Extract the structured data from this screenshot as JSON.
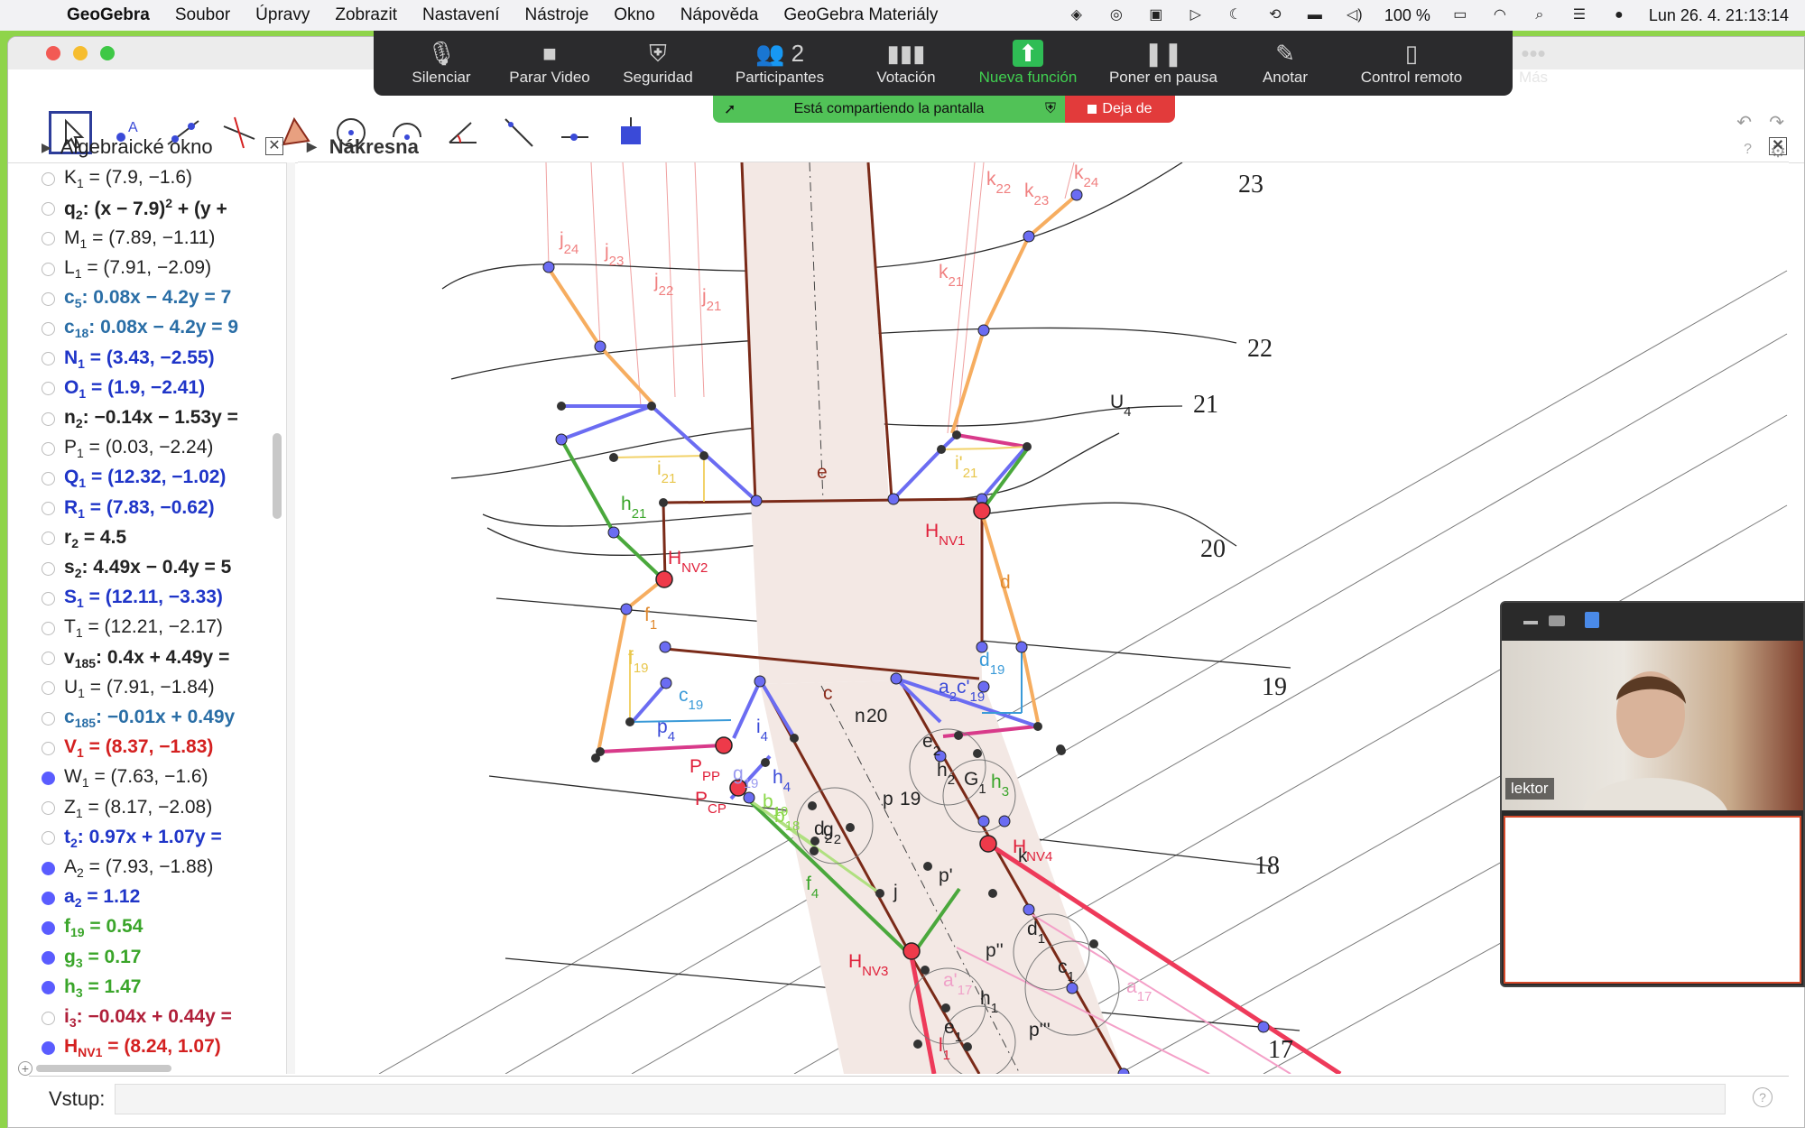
{
  "menubar": {
    "app": "GeoGebra",
    "items": [
      "Soubor",
      "Úpravy",
      "Zobrazit",
      "Nastavení",
      "Nástroje",
      "Okno",
      "Nápověda",
      "GeoGebra Materiály"
    ],
    "battery": "100 %",
    "datetime": "Lun 26. 4.  21:13:14"
  },
  "zoom": {
    "buttons": [
      {
        "label": "Silenciar",
        "icon": "microphone-icon",
        "glyph": "🎙"
      },
      {
        "label": "Parar Video",
        "icon": "video-camera-icon",
        "glyph": "■"
      },
      {
        "label": "Seguridad",
        "icon": "shield-icon",
        "glyph": "⛨"
      },
      {
        "label": "Participantes",
        "icon": "participants-icon",
        "glyph": "👥 2"
      },
      {
        "label": "Votación",
        "icon": "poll-icon",
        "glyph": "▮▮▮"
      },
      {
        "label": "Nueva función",
        "icon": "share-screen-icon",
        "glyph": "⬆"
      },
      {
        "label": "Poner en pausa",
        "icon": "pause-icon",
        "glyph": "❚❚"
      },
      {
        "label": "Anotar",
        "icon": "pencil-icon",
        "glyph": "✎"
      },
      {
        "label": "Control remoto",
        "icon": "mouse-icon",
        "glyph": "▯"
      },
      {
        "label": "Más",
        "icon": "more-icon",
        "glyph": "•••"
      }
    ],
    "share_text": "Está compartiendo la pantalla",
    "stop_text": "Deja de"
  },
  "panels": {
    "algebra_title": "Algebraické okno",
    "canvas_title": "Nákresna"
  },
  "algebra": [
    {
      "html": "K<sub>1</sub> = (7.9, −1.6)",
      "color": "#222222",
      "bold": false,
      "on": false
    },
    {
      "html": "q<sub>2</sub>: (x − 7.9)<sup>2</sup> + (y +",
      "color": "#222222",
      "bold": true,
      "on": false
    },
    {
      "html": "M<sub>1</sub> = (7.89, −1.11)",
      "color": "#222222",
      "bold": false,
      "on": false
    },
    {
      "html": "L<sub>1</sub> = (7.91, −2.09)",
      "color": "#222222",
      "bold": false,
      "on": false
    },
    {
      "html": "c<sub>5</sub>: 0.08x − 4.2y = 7",
      "color": "#2a6ea6",
      "bold": true,
      "on": false
    },
    {
      "html": "c<sub>18</sub>: 0.08x − 4.2y = 9",
      "color": "#2a6ea6",
      "bold": true,
      "on": false
    },
    {
      "html": "N<sub>1</sub> = (3.43, −2.55)",
      "color": "#1f35c8",
      "bold": true,
      "on": false
    },
    {
      "html": "O<sub>1</sub> = (1.9, −2.41)",
      "color": "#1f35c8",
      "bold": true,
      "on": false
    },
    {
      "html": "n<sub>2</sub>: −0.14x − 1.53y =",
      "color": "#222222",
      "bold": true,
      "on": false
    },
    {
      "html": "P<sub>1</sub> = (0.03, −2.24)",
      "color": "#222222",
      "bold": false,
      "on": false
    },
    {
      "html": "Q<sub>1</sub> = (12.32, −1.02)",
      "color": "#1f35c8",
      "bold": true,
      "on": false
    },
    {
      "html": "R<sub>1</sub> = (7.83, −0.62)",
      "color": "#1f35c8",
      "bold": true,
      "on": false
    },
    {
      "html": "r<sub>2</sub> = 4.5",
      "color": "#222222",
      "bold": true,
      "on": false
    },
    {
      "html": "s<sub>2</sub>: 4.49x − 0.4y = 5",
      "color": "#222222",
      "bold": true,
      "on": false
    },
    {
      "html": "S<sub>1</sub> = (12.11, −3.33)",
      "color": "#1f35c8",
      "bold": true,
      "on": false
    },
    {
      "html": "T<sub>1</sub> = (12.21, −2.17)",
      "color": "#222222",
      "bold": false,
      "on": false
    },
    {
      "html": "v<sub>185</sub>: 0.4x + 4.49y =",
      "color": "#222222",
      "bold": true,
      "on": false
    },
    {
      "html": "U<sub>1</sub> = (7.91, −1.84)",
      "color": "#222222",
      "bold": false,
      "on": false
    },
    {
      "html": "c<sub>185</sub>: −0.01x + 0.49y",
      "color": "#2a6ea6",
      "bold": true,
      "on": false
    },
    {
      "html": "V<sub>1</sub> = (8.37, −1.83)",
      "color": "#d42020",
      "bold": true,
      "on": false
    },
    {
      "html": "W<sub>1</sub> = (7.63, −1.6)",
      "color": "#222222",
      "bold": false,
      "on": true
    },
    {
      "html": "Z<sub>1</sub> = (8.17, −2.08)",
      "color": "#222222",
      "bold": false,
      "on": false
    },
    {
      "html": "t<sub>2</sub>: 0.97x + 1.07y =",
      "color": "#1f35c8",
      "bold": true,
      "on": false
    },
    {
      "html": "A<sub>2</sub> = (7.93, −1.88)",
      "color": "#222222",
      "bold": false,
      "on": true
    },
    {
      "html": "a<sub>2</sub> = 1.12",
      "color": "#1f35c8",
      "bold": true,
      "on": true
    },
    {
      "html": "f<sub>19</sub> = 0.54",
      "color": "#3aa52a",
      "bold": true,
      "on": true
    },
    {
      "html": "g<sub>3</sub> = 0.17",
      "color": "#3aa52a",
      "bold": true,
      "on": true
    },
    {
      "html": "h<sub>3</sub> = 1.47",
      "color": "#3aa52a",
      "bold": true,
      "on": true
    },
    {
      "html": "i<sub>3</sub>: −0.04x + 0.44y =",
      "color": "#b0203a",
      "bold": true,
      "on": false
    },
    {
      "html": "H<sub>NV1</sub> = (8.24, 1.07)",
      "color": "#d42020",
      "bold": true,
      "on": true
    }
  ],
  "input": {
    "label": "Vstup:"
  },
  "video": {
    "name": "lektor"
  },
  "canvas": {
    "contour_labels": [
      "23",
      "22",
      "21",
      "20",
      "19",
      "18",
      "17"
    ],
    "labels": [
      {
        "t": "j<tspan baseline-shift='sub' font-size='15'>24</tspan>",
        "c": "#f08080"
      },
      {
        "t": "j<tspan baseline-shift='sub' font-size='15'>23</tspan>",
        "c": "#f08080"
      },
      {
        "t": "j<tspan baseline-shift='sub' font-size='15'>22</tspan>",
        "c": "#f08080"
      },
      {
        "t": "j<tspan baseline-shift='sub' font-size='15'>21</tspan>",
        "c": "#f08080"
      },
      {
        "t": "k<tspan baseline-shift='sub' font-size='15'>22</tspan>",
        "c": "#f08080"
      },
      {
        "t": "k<tspan baseline-shift='sub' font-size='15'>23</tspan>",
        "c": "#f08080"
      },
      {
        "t": "k<tspan baseline-shift='sub' font-size='15'>24</tspan>",
        "c": "#f08080"
      },
      {
        "t": "k<tspan baseline-shift='sub' font-size='15'>21</tspan>",
        "c": "#f08080"
      },
      {
        "t": "U<tspan baseline-shift='sub' font-size='15'>4</tspan>",
        "c": "#222"
      },
      {
        "t": "i<tspan baseline-shift='sub' font-size='15'>21</tspan>",
        "c": "#e8c64a"
      },
      {
        "t": "i'<tspan baseline-shift='sub' font-size='15'>21</tspan>",
        "c": "#e8c64a"
      },
      {
        "t": "h<tspan baseline-shift='sub' font-size='15'>21</tspan>",
        "c": "#3aa52a"
      },
      {
        "t": "e",
        "c": "#8b2a1a"
      },
      {
        "t": "H<tspan baseline-shift='sub' font-size='15'>NV1</tspan>",
        "c": "#e0203a"
      },
      {
        "t": "H<tspan baseline-shift='sub' font-size='15'>NV2</tspan>",
        "c": "#e0203a"
      },
      {
        "t": "d",
        "c": "#e08a30"
      },
      {
        "t": "f<tspan baseline-shift='sub' font-size='15'>1</tspan>",
        "c": "#e08a30"
      },
      {
        "t": "f<tspan baseline-shift='sub' font-size='15'>19</tspan>",
        "c": "#e8c64a"
      },
      {
        "t": "d<tspan baseline-shift='sub' font-size='15'>19</tspan>",
        "c": "#3a9ad8"
      },
      {
        "t": "c<tspan baseline-shift='sub' font-size='15'>19</tspan>",
        "c": "#3a9ad8"
      },
      {
        "t": "c",
        "c": "#8b2a1a"
      },
      {
        "t": "a<tspan baseline-shift='sub' font-size='15'>2</tspan>c'<tspan baseline-shift='sub' font-size='15'>19</tspan>",
        "c": "#3a4ad8"
      },
      {
        "t": "p<tspan baseline-shift='sub' font-size='15'>4</tspan>",
        "c": "#3a4ad8"
      },
      {
        "t": "i<tspan baseline-shift='sub' font-size='15'>4</tspan>",
        "c": "#3a4ad8"
      },
      {
        "t": "n",
        "c": "#222"
      },
      {
        "t": "20",
        "c": "#222"
      },
      {
        "t": "P<tspan baseline-shift='sub' font-size='15'>PP</tspan>",
        "c": "#e0203a"
      },
      {
        "t": "P<tspan baseline-shift='sub' font-size='15'>CP</tspan>",
        "c": "#e0203a"
      },
      {
        "t": "g<tspan baseline-shift='sub' font-size='15'>19</tspan>",
        "c": "#9a9af0"
      },
      {
        "t": "h<tspan baseline-shift='sub' font-size='15'>4</tspan>",
        "c": "#3a4ad8"
      },
      {
        "t": "b<tspan baseline-shift='sub' font-size='15'>19</tspan>",
        "c": "#8ad848"
      },
      {
        "t": "b<tspan baseline-shift='sub' font-size='15'>18</tspan>",
        "c": "#8ad848"
      },
      {
        "t": "d<tspan baseline-shift='sub' font-size='15'>2</tspan>",
        "c": "#222"
      },
      {
        "t": "g<tspan baseline-shift='sub' font-size='15'>2</tspan>",
        "c": "#222"
      },
      {
        "t": "p",
        "c": "#222"
      },
      {
        "t": "19",
        "c": "#222"
      },
      {
        "t": "e<tspan baseline-shift='sub' font-size='15'>2</tspan>",
        "c": "#222"
      },
      {
        "t": "h<tspan baseline-shift='sub' font-size='15'>2</tspan>",
        "c": "#222"
      },
      {
        "t": "G<tspan baseline-shift='sub' font-size='15'>1</tspan>",
        "c": "#222"
      },
      {
        "t": "h<tspan baseline-shift='sub' font-size='15'>3</tspan>",
        "c": "#3aa52a"
      },
      {
        "t": "H<tspan baseline-shift='sub' font-size='15'>NV4</tspan>",
        "c": "#e0203a"
      },
      {
        "t": "k",
        "c": "#222"
      },
      {
        "t": "f<tspan baseline-shift='sub' font-size='15'>4</tspan>",
        "c": "#3aa52a"
      },
      {
        "t": "j",
        "c": "#222"
      },
      {
        "t": "p'",
        "c": "#222"
      },
      {
        "t": "H<tspan baseline-shift='sub' font-size='15'>NV3</tspan>",
        "c": "#e0203a"
      },
      {
        "t": "p''",
        "c": "#222"
      },
      {
        "t": "d<tspan baseline-shift='sub' font-size='15'>1</tspan>",
        "c": "#222"
      },
      {
        "t": "c<tspan baseline-shift='sub' font-size='15'>1</tspan>",
        "c": "#222"
      },
      {
        "t": "a'<tspan baseline-shift='sub' font-size='15'>17</tspan>",
        "c": "#f0a0c8"
      },
      {
        "t": "a<tspan baseline-shift='sub' font-size='15'>17</tspan>",
        "c": "#f0a0c8"
      },
      {
        "t": "h<tspan baseline-shift='sub' font-size='15'>1</tspan>",
        "c": "#222"
      },
      {
        "t": "e<tspan baseline-shift='sub' font-size='15'>1</tspan>",
        "c": "#222"
      },
      {
        "t": "l<tspan baseline-shift='sub' font-size='15'>1</tspan>",
        "c": "#e0203a"
      },
      {
        "t": "p'''",
        "c": "#222"
      }
    ]
  }
}
